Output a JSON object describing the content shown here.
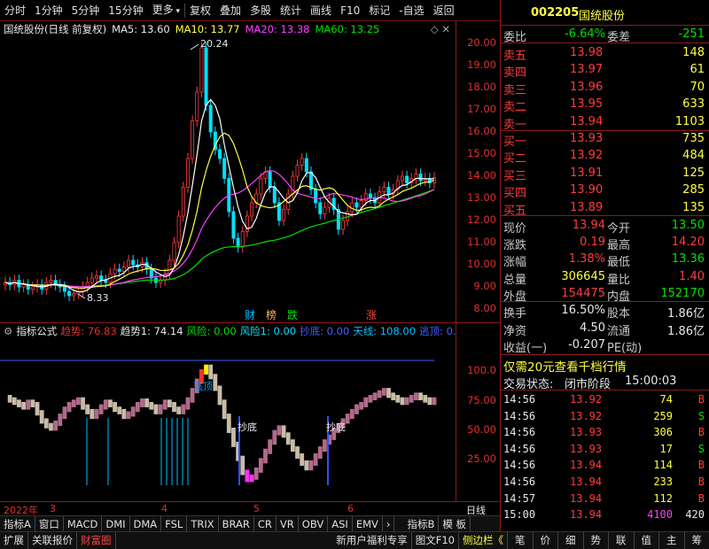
{
  "toolbar": {
    "items": [
      "分时",
      "1分钟",
      "5分钟",
      "15分钟",
      "更多",
      "复权",
      "叠加",
      "多股",
      "统计",
      "画线",
      "F10",
      "标记",
      "-自选",
      "返回"
    ]
  },
  "chart": {
    "title": "国统股份(日线 前复权)",
    "ma5": "MA5: 13.60",
    "ma10": "MA10: 13.77",
    "ma20": "MA20: 13.38",
    "ma60": "MA60: 13.25",
    "high_label": "20.24",
    "low_label": "8.33",
    "price_ticks": [
      "20.00",
      "19.00",
      "18.00",
      "17.00",
      "16.00",
      "15.00",
      "14.00",
      "13.00",
      "12.00",
      "11.00",
      "10.00",
      "9.00",
      "8.00"
    ],
    "markers": [
      "财",
      "榜",
      "跌",
      "涨"
    ],
    "colors": {
      "up": "#ff3c3c",
      "down": "#00e0ff",
      "ma5": "#ffffff",
      "ma10": "#ffff40",
      "ma20": "#ff40ff",
      "ma60": "#00e000"
    }
  },
  "indicator": {
    "name": "指标公式",
    "trend": "趋势: 76.83",
    "trend1": "趋势1: 74.14",
    "risk": "风险: 0.00",
    "risk1": "风险1: 0.00",
    "bottom": "抄底: 0.00",
    "sky": "天线: 108.00",
    "escape": "逃顶: 0.0",
    "ticks": [
      "100.0",
      "75.00",
      "50.00",
      "25.00"
    ],
    "labels": {
      "escape": "逃顶",
      "bottom": "抄底"
    }
  },
  "dates": {
    "year": "2022年",
    "months": [
      "3",
      "4",
      "5",
      "6"
    ],
    "right": "日线"
  },
  "indicator_tabs": [
    "指标A",
    "窗口",
    "MACD",
    "DMI",
    "DMA",
    "FSL",
    "TRIX",
    "BRAR",
    "CR",
    "VR",
    "OBV",
    "ASI",
    "EMV",
    "指标B",
    "模 板"
  ],
  "bottom_bar": {
    "left": [
      "扩展",
      "关联报价",
      "财富圈"
    ],
    "news": "新用户福利专享",
    "f10": "图文F10",
    "side": "侧边栏《",
    "icons": [
      "笔",
      "价",
      "细",
      "势",
      "联",
      "值",
      "主",
      "筹"
    ]
  },
  "quote": {
    "code": "002205",
    "name": "国统股份",
    "weibi_label": "委比",
    "weibi": "-6.64%",
    "weicha_label": "委差",
    "weicha": "-251",
    "asks": [
      {
        "label": "卖五",
        "price": "13.98",
        "vol": "148"
      },
      {
        "label": "卖四",
        "price": "13.97",
        "vol": "61"
      },
      {
        "label": "卖三",
        "price": "13.96",
        "vol": "70"
      },
      {
        "label": "卖二",
        "price": "13.95",
        "vol": "633"
      },
      {
        "label": "卖一",
        "price": "13.94",
        "vol": "1103"
      }
    ],
    "bids": [
      {
        "label": "买一",
        "price": "13.93",
        "vol": "735"
      },
      {
        "label": "买二",
        "price": "13.92",
        "vol": "484"
      },
      {
        "label": "买三",
        "price": "13.91",
        "vol": "125"
      },
      {
        "label": "买四",
        "price": "13.90",
        "vol": "285"
      },
      {
        "label": "买五",
        "price": "13.89",
        "vol": "135"
      }
    ],
    "stats": [
      {
        "l1": "现价",
        "v1": "13.94",
        "l2": "今开",
        "v2": "13.50"
      },
      {
        "l1": "涨跌",
        "v1": "0.19",
        "l2": "最高",
        "v2": "14.20"
      },
      {
        "l1": "涨幅",
        "v1": "1.38%",
        "l2": "最低",
        "v2": "13.36"
      },
      {
        "l1": "总量",
        "v1": "306645",
        "l2": "量比",
        "v2": "1.40"
      },
      {
        "l1": "外盘",
        "v1": "154475",
        "l2": "内盘",
        "v2": "152170"
      }
    ],
    "stats2": [
      {
        "l1": "换手",
        "v1": "16.50%",
        "l2": "股本",
        "v2": "1.86亿"
      },
      {
        "l1": "净资",
        "v1": "4.50",
        "l2": "流通",
        "v2": "1.86亿"
      },
      {
        "l1": "收益(一)",
        "v1": "-0.207",
        "l2": "PE(动)",
        "v2": ""
      }
    ],
    "promo": "仅需20元查看千档行情",
    "status_label": "交易状态:",
    "status_value": "闭市阶段",
    "status_time": "15:00:03",
    "trades": [
      {
        "t": "14:56",
        "p": "13.92",
        "v": "74",
        "s": "B"
      },
      {
        "t": "14:56",
        "p": "13.92",
        "v": "259",
        "s": "S"
      },
      {
        "t": "14:56",
        "p": "13.93",
        "v": "306",
        "s": "B"
      },
      {
        "t": "14:56",
        "p": "13.93",
        "v": "17",
        "s": "S"
      },
      {
        "t": "14:56",
        "p": "13.94",
        "v": "114",
        "s": "B"
      },
      {
        "t": "14:56",
        "p": "13.94",
        "v": "233",
        "s": "B"
      },
      {
        "t": "14:57",
        "p": "13.94",
        "v": "112",
        "s": "B"
      },
      {
        "t": "15:00",
        "p": "13.94",
        "v": "4100",
        "s": "420"
      }
    ]
  }
}
